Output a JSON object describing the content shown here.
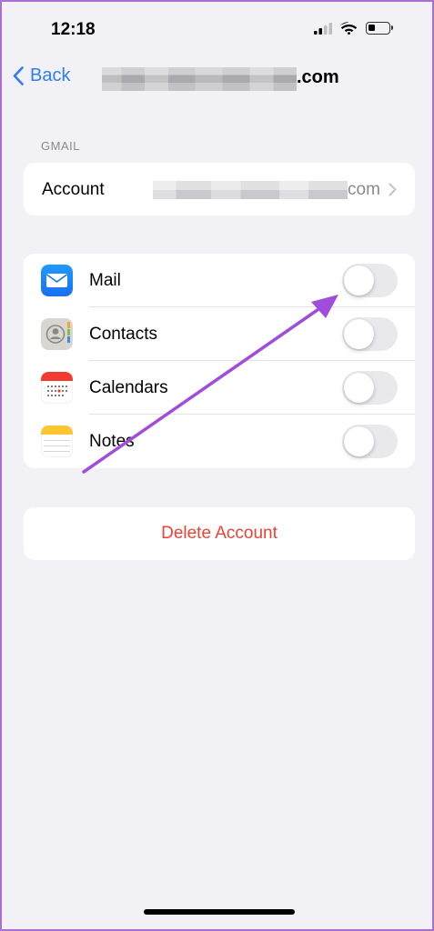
{
  "status_bar": {
    "time": "12:18",
    "icons": [
      "cellular-signal-icon",
      "wifi-icon",
      "battery-icon"
    ],
    "battery_level": 0.35
  },
  "nav": {
    "back_label": "Back",
    "title_suffix": ".com"
  },
  "section": {
    "header": "GMAIL"
  },
  "account": {
    "label": "Account",
    "value_suffix": "com"
  },
  "services": [
    {
      "label": "Mail",
      "icon": "mail-icon",
      "enabled": false
    },
    {
      "label": "Contacts",
      "icon": "contacts-icon",
      "enabled": false
    },
    {
      "label": "Calendars",
      "icon": "calendar-icon",
      "enabled": false
    },
    {
      "label": "Notes",
      "icon": "notes-icon",
      "enabled": false
    }
  ],
  "delete": {
    "label": "Delete Account"
  },
  "colors": {
    "accent": "#2f7cf6",
    "destructive": "#ea4335",
    "annotation_arrow": "#a04ddb",
    "frame_border": "#a86fd4",
    "background": "#f2f1f6"
  }
}
